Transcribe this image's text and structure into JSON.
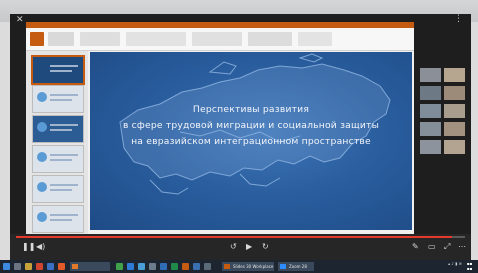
{
  "presentation": {
    "title_lines": [
      "Перспективы развития",
      "в сфере трудовой миграции и социальной защиты",
      "на евразийском интеграционном пространстве"
    ]
  },
  "taskbar": {
    "windows": [
      {
        "label": "Slides 30 Workplace"
      },
      {
        "label": "Zoom 28"
      }
    ]
  },
  "colors": {
    "slide_bg": "#2a5e9f",
    "ribbon_accent": "#c55a11",
    "progress": "#e33a2b",
    "taskbar": "#1c2530"
  },
  "player": {
    "progress_fraction": 0.97
  }
}
